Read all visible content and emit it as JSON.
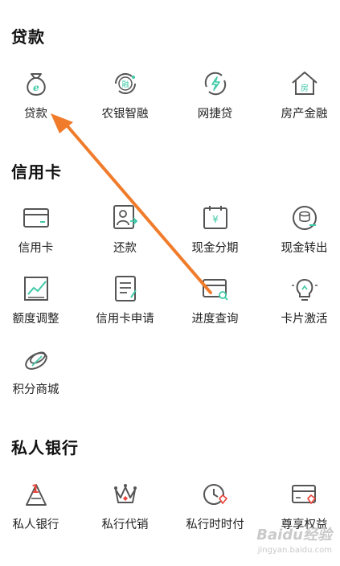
{
  "sections": [
    {
      "title": "贷款",
      "items": [
        {
          "label": "贷款",
          "icon": "loan-bag-icon"
        },
        {
          "label": "农银智融",
          "icon": "rong-coin-icon"
        },
        {
          "label": "网捷贷",
          "icon": "lightning-coin-icon"
        },
        {
          "label": "房产金融",
          "icon": "house-icon"
        }
      ]
    },
    {
      "title": "信用卡",
      "items": [
        {
          "label": "信用卡",
          "icon": "credit-card-icon"
        },
        {
          "label": "还款",
          "icon": "repayment-person-icon"
        },
        {
          "label": "现金分期",
          "icon": "calendar-yen-icon"
        },
        {
          "label": "现金转出",
          "icon": "coin-transfer-icon"
        },
        {
          "label": "额度调整",
          "icon": "trend-chart-icon"
        },
        {
          "label": "信用卡申请",
          "icon": "application-form-icon"
        },
        {
          "label": "进度查询",
          "icon": "card-search-icon"
        },
        {
          "label": "卡片激活",
          "icon": "lightbulb-icon"
        },
        {
          "label": "积分商城",
          "icon": "points-coin-icon"
        }
      ]
    },
    {
      "title": "私人银行",
      "items": [
        {
          "label": "私人银行",
          "icon": "private-bank-icon"
        },
        {
          "label": "私行代销",
          "icon": "crown-icon"
        },
        {
          "label": "私行时时付",
          "icon": "clock-diamond-icon"
        },
        {
          "label": "尊享权益",
          "icon": "card-diamond-icon"
        }
      ]
    }
  ],
  "watermark": {
    "main": "Baidu经验",
    "sub": "jingyan.baidu.com"
  },
  "colors": {
    "icon_stroke": "#555555",
    "accent_green": "#3ec9a7",
    "accent_red": "#e8443a",
    "arrow": "#f07c2b"
  }
}
